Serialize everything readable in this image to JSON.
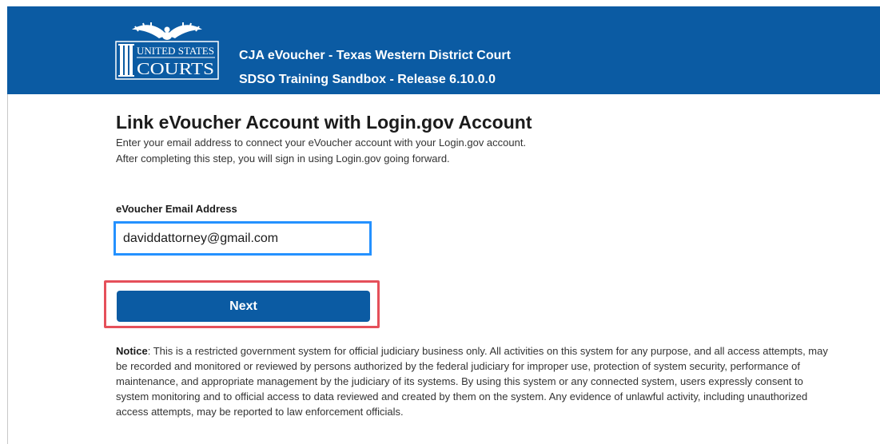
{
  "header": {
    "logo": {
      "icon": "us-courts-eagle-logo",
      "line1": "UNITED STATES",
      "line2": "COURTS"
    },
    "title": "CJA eVoucher - Texas Western District Court",
    "subtitle": "SDSO Training Sandbox - Release 6.10.0.0"
  },
  "main": {
    "heading": "Link eVoucher Account with Login.gov Account",
    "description_line1": "Enter your email address to connect your eVoucher account with your Login.gov account.",
    "description_line2": "After completing this step, you will sign in using Login.gov going forward.",
    "email_label": "eVoucher Email Address",
    "email_value": "daviddattorney@gmail.com",
    "next_label": "Next"
  },
  "notice": {
    "label": "Notice",
    "text": ": This is a restricted government system for official judiciary business only. All activities on this system for any purpose, and all access attempts, may be recorded and monitored or reviewed by persons authorized by the federal judiciary for improper use, protection of system security, performance of maintenance, and appropriate management by the judiciary of its systems. By using this system or any connected system, users expressly consent to system monitoring and to official access to data reviewed and created by them on the system. Any evidence of unlawful activity, including unauthorized access attempts, may be reported to law enforcement officials."
  },
  "colors": {
    "header_bg": "#0b5ba3",
    "button_bg": "#0b5ba3",
    "input_focus_border": "#2491ff",
    "annotation_highlight": "#e5505a"
  }
}
